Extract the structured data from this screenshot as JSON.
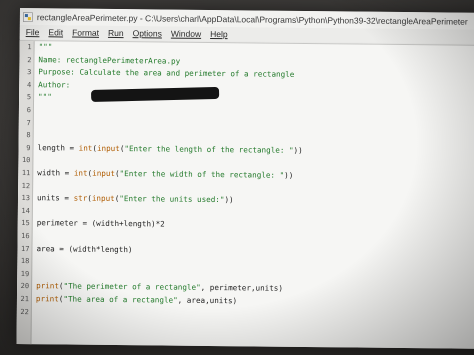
{
  "window": {
    "title": "rectangleAreaPerimeter.py - C:\\Users\\charl\\AppData\\Local\\Programs\\Python\\Python39-32\\rectangleAreaPerimeter"
  },
  "menu": [
    "File",
    "Edit",
    "Format",
    "Run",
    "Options",
    "Window",
    "Help"
  ],
  "editor": {
    "lines": [
      {
        "n": "1",
        "text": "\"\"\""
      },
      {
        "n": "2",
        "text": "Name: rectanglePerimeterArea.py"
      },
      {
        "n": "3",
        "text": "Purpose: Calculate the area and perimeter of a rectangle"
      },
      {
        "n": "4",
        "text": "Author:"
      },
      {
        "n": "5",
        "text": "\"\"\""
      },
      {
        "n": "6",
        "text": ""
      },
      {
        "n": "7",
        "text": ""
      },
      {
        "n": "8",
        "text": ""
      },
      {
        "n": "9",
        "text": "length = int(input(\"Enter the length of the rectangle: \"))"
      },
      {
        "n": "10",
        "text": ""
      },
      {
        "n": "11",
        "text": "width = int(input(\"Enter the width of the rectangle: \"))"
      },
      {
        "n": "12",
        "text": ""
      },
      {
        "n": "13",
        "text": "units = str(input(\"Enter the units used:\"))"
      },
      {
        "n": "14",
        "text": ""
      },
      {
        "n": "15",
        "text": "perimeter = (width+length)*2"
      },
      {
        "n": "16",
        "text": ""
      },
      {
        "n": "17",
        "text": "area = (width*length)"
      },
      {
        "n": "18",
        "text": ""
      },
      {
        "n": "19",
        "text": ""
      },
      {
        "n": "20",
        "text": "print(\"The perimeter of a rectangle\", perimeter,units)"
      },
      {
        "n": "21",
        "text": "print(\"The area of a rectangle\", area,units)"
      },
      {
        "n": "22",
        "text": ""
      }
    ]
  },
  "colors": {
    "docstring": "#237a2b",
    "string": "#237a2b",
    "builtin": "#b05c00",
    "default": "#1f1f1f"
  }
}
